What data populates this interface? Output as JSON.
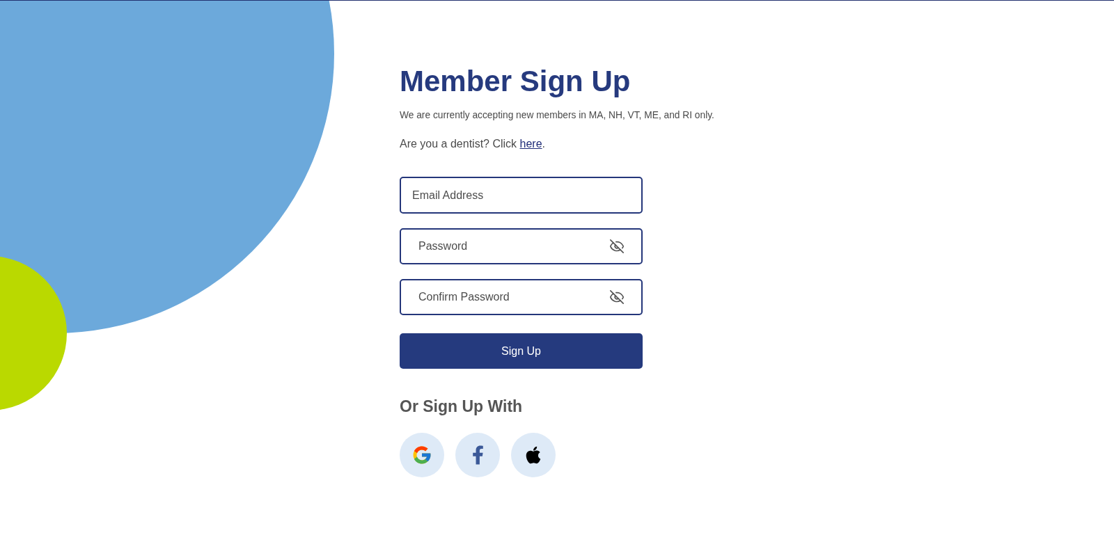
{
  "heading": {
    "title": "Member Sign Up",
    "notice": "We are currently accepting new members in MA, NH, VT, ME, and RI only.",
    "dentist_prompt": {
      "text": "Are you a dentist? Click",
      "link": "here",
      "end": "."
    }
  },
  "form": {
    "fields": [
      {
        "kind": "email",
        "placeholder": "Email Address"
      },
      {
        "kind": "password",
        "placeholder": "Password"
      },
      {
        "kind": "password",
        "placeholder": "Confirm Password"
      }
    ],
    "submit": "Sign Up"
  },
  "social": {
    "heading": "Or Sign Up With"
  }
}
